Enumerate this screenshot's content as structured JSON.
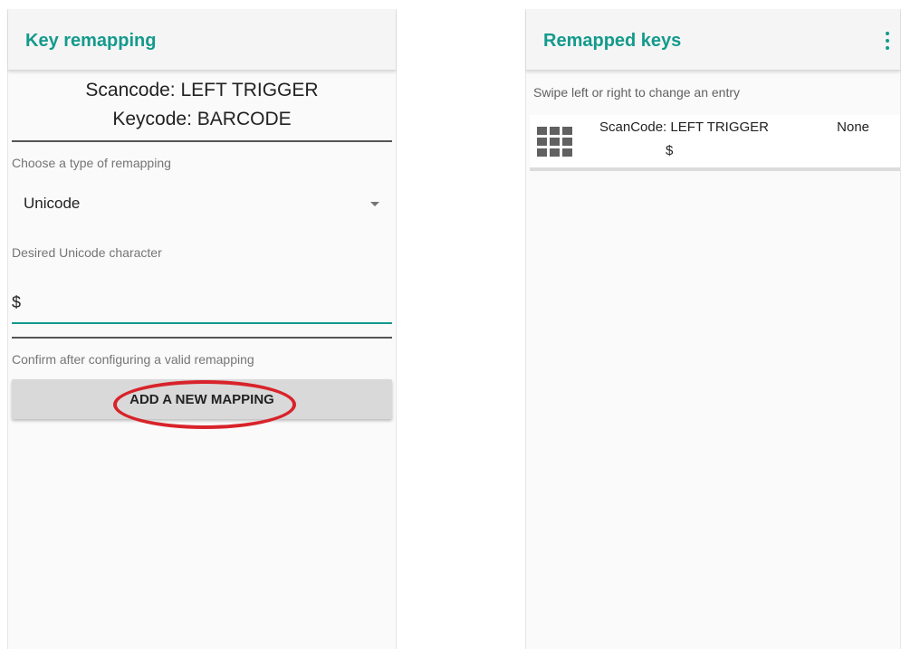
{
  "left_screen": {
    "title": "Key remapping",
    "scancode": "Scancode: LEFT TRIGGER",
    "keycode": "Keycode: BARCODE",
    "type_label": "Choose a type of remapping",
    "type_value": "Unicode",
    "unicode_label": "Desired Unicode character",
    "unicode_value": "$",
    "confirm_label": "Confirm after configuring a valid remapping",
    "add_button_label": "ADD A NEW MAPPING"
  },
  "right_screen": {
    "title": "Remapped keys",
    "swipe_hint": "Swipe left or right to change an entry",
    "entries": [
      {
        "scancode": "ScanCode: LEFT TRIGGER",
        "result": "$",
        "status": "None",
        "icon": "grid-icon"
      }
    ]
  },
  "colors": {
    "accent": "#139a8c",
    "highlight": "#d8232a",
    "button_bg": "#d9d9d9"
  }
}
